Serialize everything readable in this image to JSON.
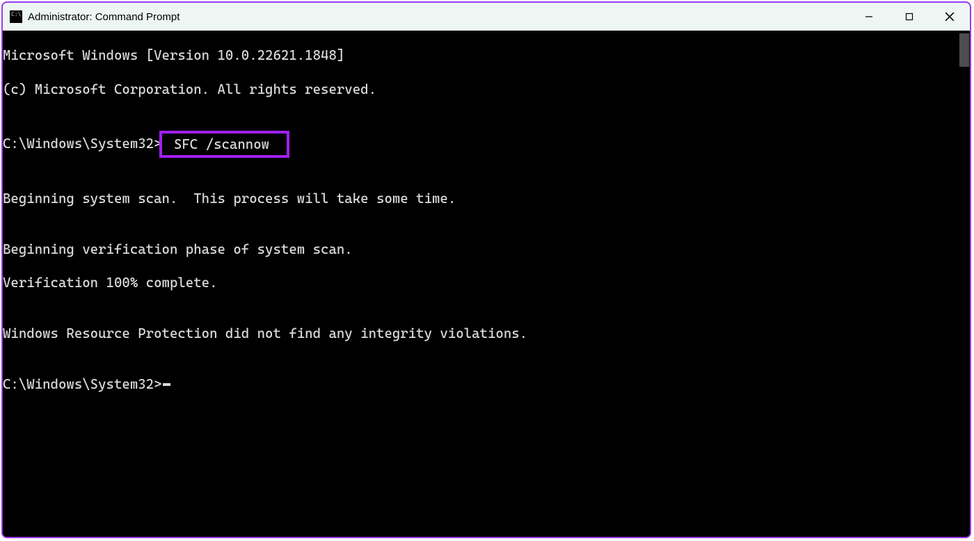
{
  "window": {
    "title": "Administrator: Command Prompt"
  },
  "terminal": {
    "line1": "Microsoft Windows [Version 10.0.22621.1848]",
    "line2": "(c) Microsoft Corporation. All rights reserved.",
    "blank": "",
    "prompt1_prefix": "C:\\Windows\\System32>",
    "command": " SFC /scannow ",
    "line3": "Beginning system scan.  This process will take some time.",
    "line4": "Beginning verification phase of system scan.",
    "line5": "Verification 100% complete.",
    "line6": "Windows Resource Protection did not find any integrity violations.",
    "prompt2": "C:\\Windows\\System32>"
  }
}
